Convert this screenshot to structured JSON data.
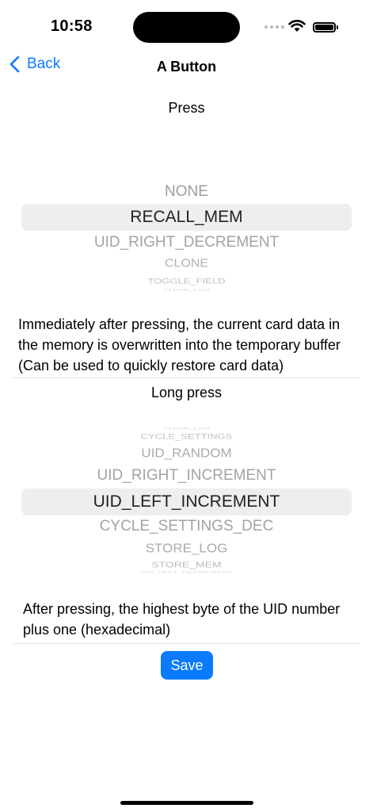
{
  "status_bar": {
    "time": "10:58"
  },
  "nav": {
    "back_label": "Back",
    "title": "A Button"
  },
  "press": {
    "label": "Press",
    "options_above": [
      "NONE"
    ],
    "selected": "RECALL_MEM",
    "options_below": [
      "UID_RIGHT_DECREMENT",
      "CLONE",
      "TOGGLE_FIELD",
      "CLEAR_LOG"
    ],
    "description": "Immediately after pressing, the current card data in the memory is overwritten into the temporary buffer (Can be used to quickly restore card data)"
  },
  "long_press": {
    "label": "Long press",
    "options_above": [
      "CLEAR_LOG",
      "CYCLE_SETTINGS",
      "UID_RANDOM",
      "UID_RIGHT_INCREMENT"
    ],
    "selected": "UID_LEFT_INCREMENT",
    "options_below": [
      "CYCLE_SETTINGS_DEC",
      "STORE_LOG",
      "STORE_MEM",
      "UID_LEFT_DECREMENT"
    ],
    "description": "After pressing, the highest byte of the UID number plus one (hexadecimal)"
  },
  "save_label": "Save",
  "colors": {
    "accent": "#0a7aff",
    "picker_highlight": "#eeeeef",
    "faded_text": "#9c9c9c"
  }
}
